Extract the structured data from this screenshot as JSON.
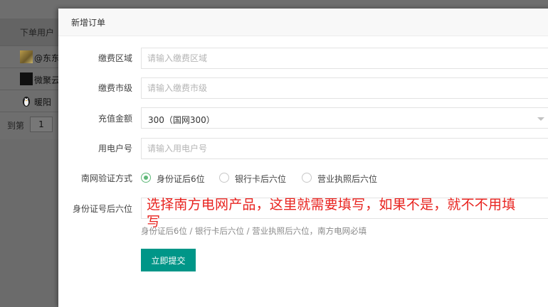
{
  "background_table": {
    "column_header": "下单用户",
    "rows": [
      {
        "name": "@东东"
      },
      {
        "name": "微聚云"
      },
      {
        "name": "暖阳"
      }
    ],
    "pager": {
      "goto_label": "到第",
      "page_value": "1"
    }
  },
  "modal": {
    "title": "新增订单",
    "fields": {
      "region": {
        "label": "缴费区域",
        "placeholder": "请输入缴费区域"
      },
      "city": {
        "label": "缴费市级",
        "placeholder": "请输入缴费市级"
      },
      "amount": {
        "label": "充值金额",
        "selected": "300（国网300）"
      },
      "account": {
        "label": "用电户号",
        "placeholder": "请输入用电户号"
      },
      "verify_method": {
        "label": "南网验证方式",
        "options": [
          "身份证后6位",
          "银行卡后六位",
          "营业执照后六位"
        ],
        "selected_index": 0
      },
      "id_last6": {
        "label": "身份证号后六位",
        "placeholder": "",
        "hint": "身份证后6位 / 银行卡后六位 / 营业执照后六位，南方电网必填"
      }
    },
    "submit_label": "立即提交"
  },
  "annotation": {
    "text": "选择南方电网产品，这里就需要填写，如果不是，就不不用填写",
    "color": "#e8231f"
  },
  "colors": {
    "primary": "#009688",
    "radio_checked": "#5fb878"
  }
}
